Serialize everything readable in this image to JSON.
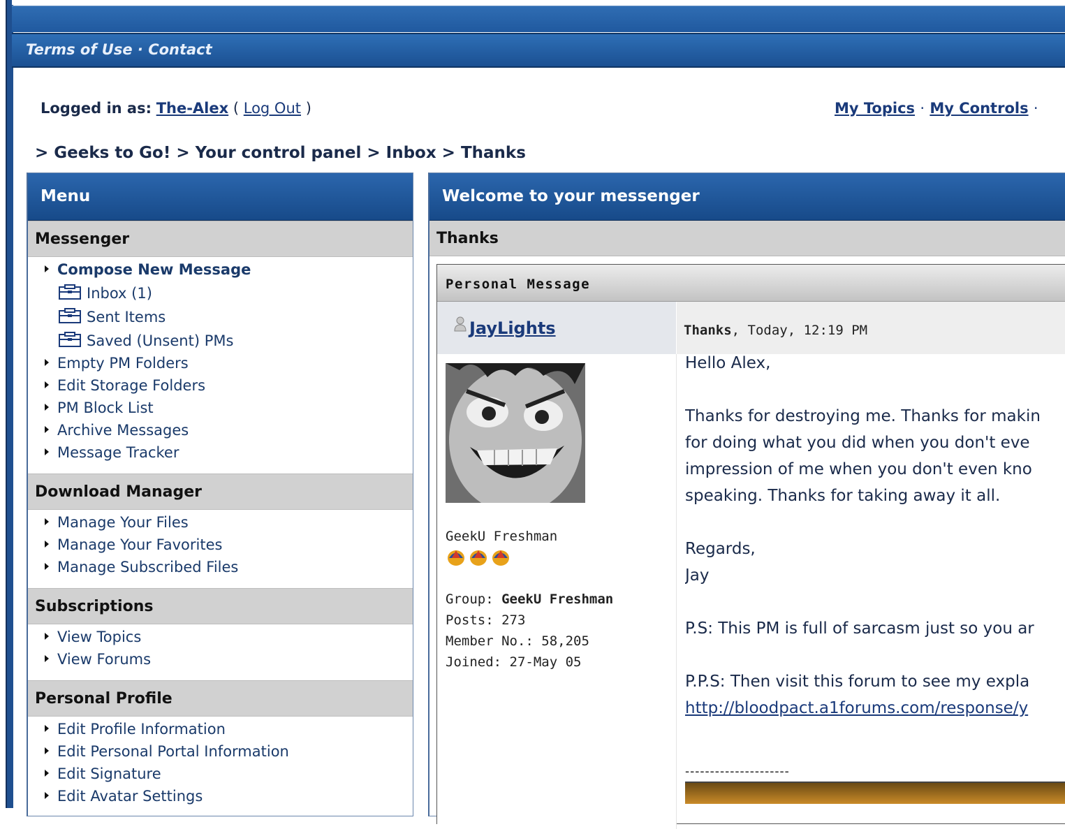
{
  "header": {
    "links": [
      "Terms of Use",
      "Contact"
    ],
    "separator": " · "
  },
  "session": {
    "logged_label": "Logged in as:",
    "username": "The-Alex",
    "logout_open": "(",
    "logout_label": "Log Out",
    "logout_close": ")"
  },
  "toplinks": {
    "my_topics": "My Topics",
    "my_controls": "My Controls",
    "sep": "·"
  },
  "breadcrumb": "> Geeks to Go! > Your control panel > Inbox > Thanks",
  "menu": {
    "title": "Menu",
    "messenger": {
      "title": "Messenger",
      "compose": "Compose New Message",
      "folders": [
        "Inbox (1)",
        "Sent Items",
        "Saved (Unsent) PMs"
      ],
      "items": [
        "Empty PM Folders",
        "Edit Storage Folders",
        "PM Block List",
        "Archive Messages",
        "Message Tracker"
      ]
    },
    "downloads": {
      "title": "Download Manager",
      "items": [
        "Manage Your Files",
        "Manage Your Favorites",
        "Manage Subscribed Files"
      ]
    },
    "subscriptions": {
      "title": "Subscriptions",
      "items": [
        "View Topics",
        "View Forums"
      ]
    },
    "profile": {
      "title": "Personal Profile",
      "items": [
        "Edit Profile Information",
        "Edit Personal Portal Information",
        "Edit Signature",
        "Edit Avatar Settings"
      ]
    }
  },
  "messenger": {
    "title": "Welcome to your messenger",
    "subject": "Thanks",
    "box_title": "Personal Message",
    "author": "JayLights",
    "msg_title": "Thanks",
    "msg_date": ", Today, 12:19 PM",
    "rank": "GeekU Freshman",
    "group_label": "Group:",
    "group": "GeekU Freshman",
    "posts": "Posts: 273",
    "member_no": "Member No.: 58,205",
    "joined": "Joined: 27-May 05",
    "body": [
      "Hello Alex,",
      "Thanks for destroying me. Thanks for makin",
      "for doing what you did when you don't eve",
      "impression of me when you don't even kno",
      "speaking. Thanks for taking away it all.",
      "Regards,",
      "Jay",
      "P.S: This PM is full of sarcasm just so you ar",
      "P.P.S: Then visit this forum to see my expla"
    ],
    "link": "http://bloodpact.a1forums.com/response/y",
    "signature_rule": "---------------------"
  }
}
